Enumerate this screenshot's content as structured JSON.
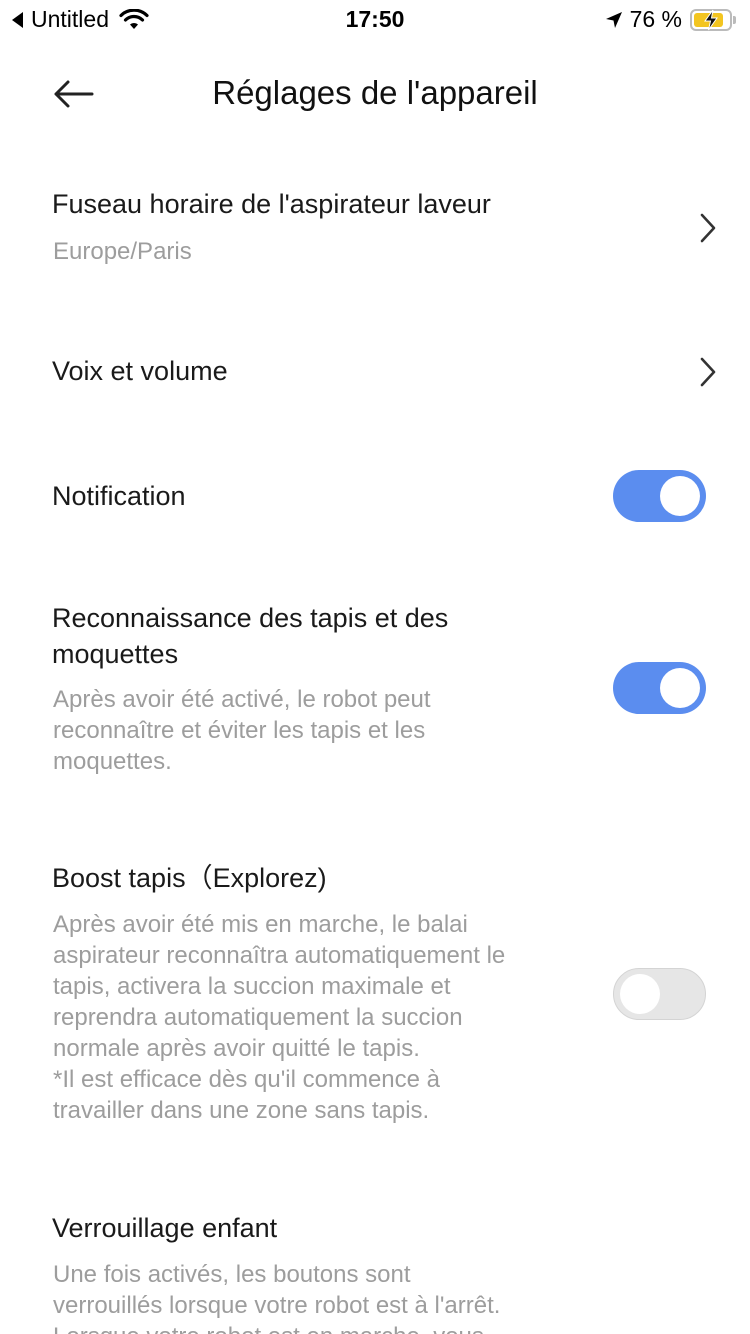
{
  "status_bar": {
    "back_app": "Untitled",
    "time": "17:50",
    "battery_percent": "76 %",
    "battery_level": 0.76
  },
  "header": {
    "title": "Réglages de l'appareil"
  },
  "settings": {
    "timezone": {
      "title": "Fuseau horaire de l'aspirateur laveur",
      "value": "Europe/Paris"
    },
    "voice": {
      "title": "Voix et volume"
    },
    "notification": {
      "title": "Notification",
      "enabled": true
    },
    "carpet_recognition": {
      "title_line1": "Reconnaissance des tapis et des",
      "title_line2": "moquettes",
      "desc_line1": "Après avoir été activé, le robot peut",
      "desc_line2": "reconnaître et éviter les tapis et les",
      "desc_line3": "moquettes.",
      "enabled": true
    },
    "carpet_boost": {
      "title": "Boost tapis（Explorez)",
      "desc_line1": "Après avoir été mis en marche, le balai",
      "desc_line2": "aspirateur reconnaîtra automatiquement le",
      "desc_line3": "tapis, activera la succion maximale et",
      "desc_line4": "reprendra automatiquement la succion",
      "desc_line5": "normale après avoir quitté le tapis.",
      "desc_line6": "*Il est efficace dès qu'il commence à",
      "desc_line7": "travailler dans une zone sans tapis.",
      "enabled": false
    },
    "child_lock": {
      "title": "Verrouillage enfant",
      "desc_line1": "Une fois activés, les boutons sont",
      "desc_line2": "verrouillés lorsque votre robot est à l'arrêt.",
      "desc_line3": "Lorsque votre robot est en marche, vous"
    }
  },
  "colors": {
    "toggle_on": "#5b8def",
    "toggle_off": "#e6e6e6",
    "secondary_text": "#9d9d9d"
  }
}
